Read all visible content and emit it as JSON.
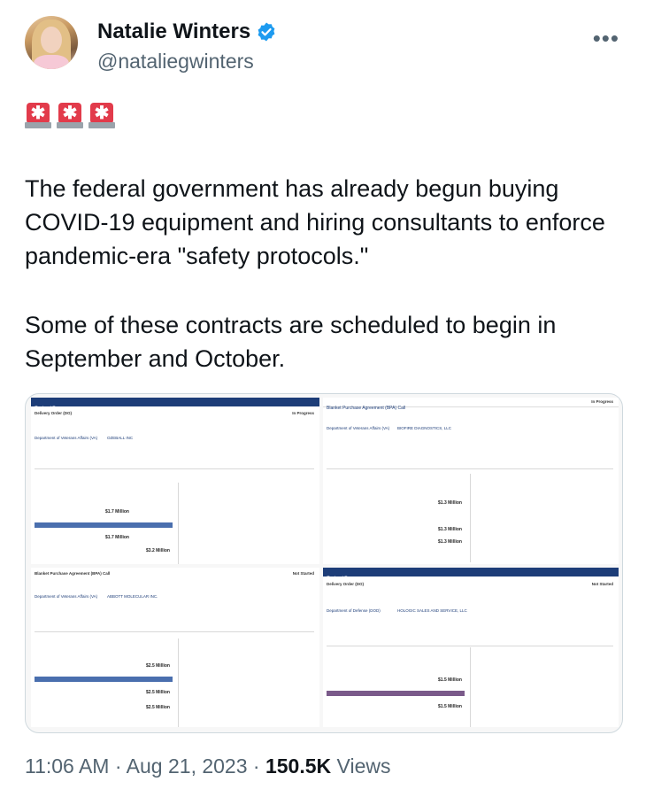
{
  "author": {
    "display_name": "Natalie Winters",
    "handle": "@nataliegwinters",
    "verified_icon": "verified-badge-icon",
    "more_icon": "more-options-icon"
  },
  "emoji": [
    "🚨",
    "🚨",
    "🚨"
  ],
  "paragraphs": [
    "The federal government has already begun buying COVID-19 equipment and hiring consultants to enforce pandemic-era \"safety protocols.\"",
    "Some of these contracts are scheduled to begin in September and October."
  ],
  "media": {
    "panels": [
      {
        "header": "Contract Summary",
        "type": "Delivery Order (DO)",
        "status": "In Progress",
        "agency": "Department of Veterans Affairs (VA)",
        "recipient": "OZEBALL INC",
        "amounts": [
          "$1.7 Million",
          "$1.7 Million",
          "$3.2 Million"
        ]
      },
      {
        "header": "Blanket Purchase Agreement (BPA) Call",
        "type": "Blanket Purchase Agreement (BPA) Call",
        "status": "In Progress",
        "agency": "Department of Veterans Affairs (VA)",
        "recipient": "BIOFIRE DIAGNOSTICS, LLC",
        "amounts": [
          "$1.3 Million",
          "$1.3 Million",
          "$1.3 Million"
        ]
      },
      {
        "header": "Blanket Purchase Agreement (BPA) Call",
        "type": "Blanket Purchase Agreement (BPA) Call",
        "status": "Not Started",
        "agency": "Department of Veterans Affairs (VA)",
        "recipient": "ABBOTT MOLECULAR INC.",
        "amounts": [
          "$2.5 Million",
          "$2.5 Million",
          "$2.5 Million"
        ]
      },
      {
        "header": "Contract Summary",
        "type": "Delivery Order (DO)",
        "status": "Not Started",
        "agency": "Department of Defense (DOD)",
        "recipient": "HOLOGIC SALES AND SERVICE, LLC",
        "amounts": [
          "$1.5 Million",
          "$1.5 Million"
        ]
      }
    ]
  },
  "footer": {
    "time": "11:06 AM",
    "sep": "·",
    "date": "Aug 21, 2023",
    "views_count": "150.5K",
    "views_label": "Views"
  },
  "colors": {
    "text": "#0f1419",
    "secondary": "#536471",
    "verified": "#1d9bf0",
    "contract_header": "#1d3d78",
    "siren": "#e23b4b"
  }
}
